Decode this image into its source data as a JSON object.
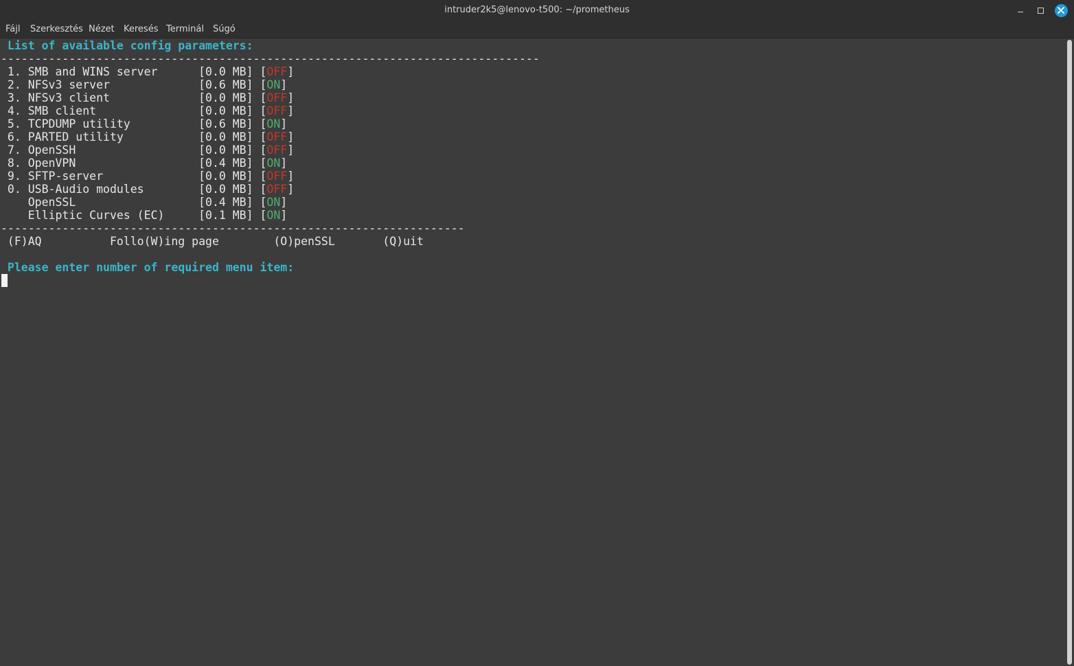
{
  "window": {
    "title": "intruder2k5@lenovo-t500: ~/prometheus"
  },
  "menu": [
    "Fájl",
    "Szerkesztés",
    "Nézet",
    "Keresés",
    "Terminál",
    "Súgó"
  ],
  "terminal": {
    "heading": " List of available config parameters:",
    "rule_long": "-------------------------------------------------------------------------------",
    "rule_short": "--------------------------------------------------------------------",
    "items": [
      {
        "label": " 1. SMB and WINS server      [0.0 MB] [",
        "state": "OFF",
        "close": "]"
      },
      {
        "label": " 2. NFSv3 server             [0.6 MB] [",
        "state": "ON",
        "close": "]"
      },
      {
        "label": " 3. NFSv3 client             [0.0 MB] [",
        "state": "OFF",
        "close": "]"
      },
      {
        "label": " 4. SMB client               [0.0 MB] [",
        "state": "OFF",
        "close": "]"
      },
      {
        "label": " 5. TCPDUMP utility          [0.6 MB] [",
        "state": "ON",
        "close": "]"
      },
      {
        "label": " 6. PARTED utility           [0.0 MB] [",
        "state": "OFF",
        "close": "]"
      },
      {
        "label": " 7. OpenSSH                  [0.0 MB] [",
        "state": "OFF",
        "close": "]"
      },
      {
        "label": " 8. OpenVPN                  [0.4 MB] [",
        "state": "ON",
        "close": "]"
      },
      {
        "label": " 9. SFTP-server              [0.0 MB] [",
        "state": "OFF",
        "close": "]"
      },
      {
        "label": " 0. USB-Audio modules        [0.0 MB] [",
        "state": "OFF",
        "close": "]"
      },
      {
        "label": "    OpenSSL                  [0.4 MB] [",
        "state": "ON",
        "close": "]"
      },
      {
        "label": "    Elliptic Curves (EC)     [0.1 MB] [",
        "state": "ON",
        "close": "]"
      }
    ],
    "options": " (F)AQ          Follo(W)ing page        (O)penSSL       (Q)uit",
    "prompt": " Please enter number of required menu item:"
  },
  "colors": {
    "heading": "#3ab6c9",
    "on": "#4fae6e",
    "off": "#c0392b",
    "close_button": "#1e9bdb"
  }
}
